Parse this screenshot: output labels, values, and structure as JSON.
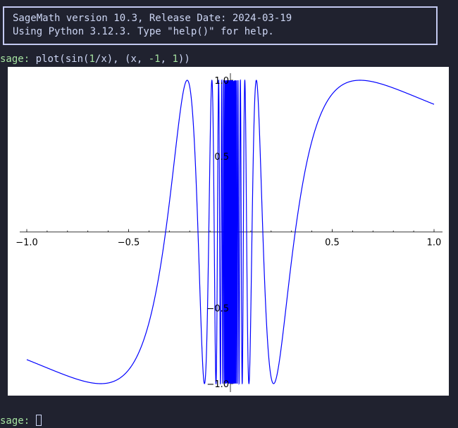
{
  "banner": {
    "line1": "SageMath version 10.3, Release Date: 2024-03-19",
    "line2": "Using Python 3.12.3. Type \"help()\" for help."
  },
  "command": {
    "prompt": "sage:",
    "pre": " plot(sin(",
    "n1": "1",
    "mid": "/x), (x, ",
    "n2": "-1",
    "sep": ", ",
    "n3": "1",
    "post": "))"
  },
  "next_prompt": "sage:",
  "colors": {
    "background": "#20222f",
    "prompt": "#a6e3a1",
    "text": "#cdd6f4",
    "curve": "#0000ff"
  },
  "chart_data": {
    "type": "line",
    "function": "sin(1/x)",
    "xlim": [
      -1,
      1
    ],
    "ylim": [
      -1,
      1
    ],
    "x_ticks": [
      {
        "v": -1.0,
        "label": "−1.0"
      },
      {
        "v": -0.5,
        "label": "−0.5"
      },
      {
        "v": 0.5,
        "label": "0.5"
      },
      {
        "v": 1.0,
        "label": "1.0"
      }
    ],
    "y_ticks": [
      {
        "v": 1.0,
        "label": "1.0"
      },
      {
        "v": 0.5,
        "label": "0.5"
      },
      {
        "v": -0.5,
        "label": "−0.5"
      },
      {
        "v": -1.0,
        "label": "−1.0"
      }
    ],
    "series_color": "#0000ff",
    "grid": false
  }
}
